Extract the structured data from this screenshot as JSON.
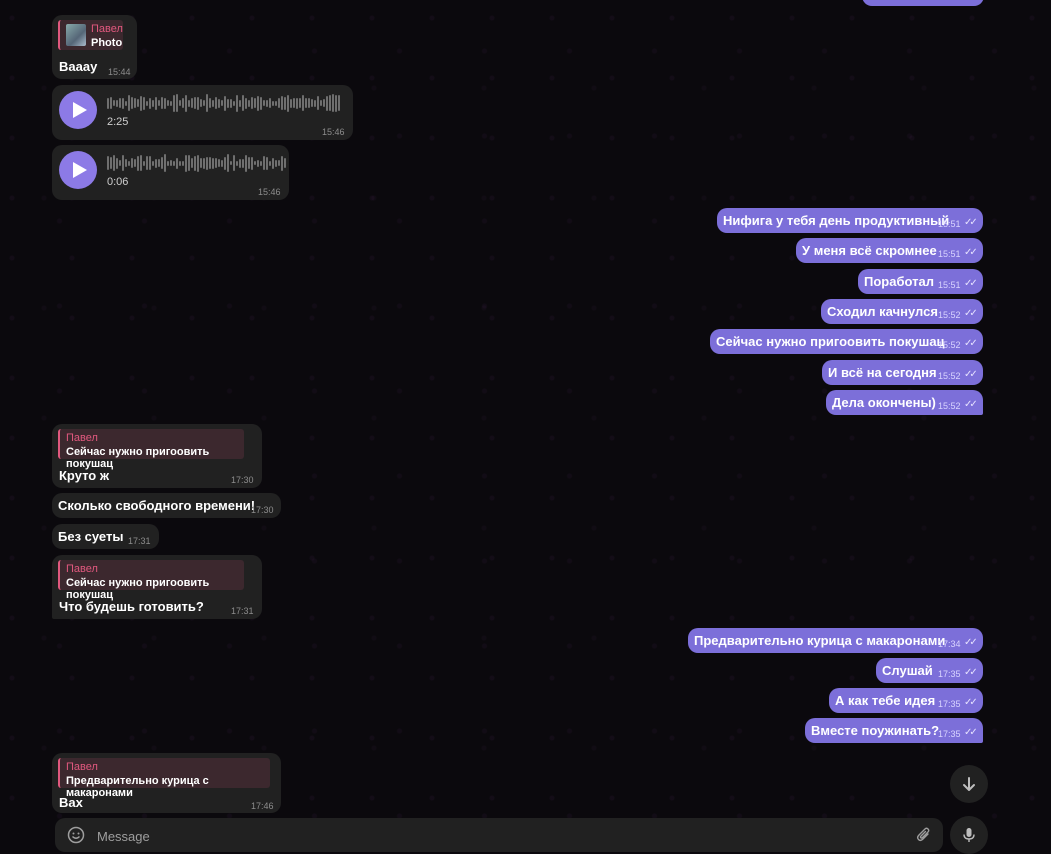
{
  "composer": {
    "placeholder": "Message"
  },
  "incoming": {
    "photo_reply": {
      "sender": "Павел",
      "label": "Photo",
      "text": "Вааау",
      "time": "15:44"
    },
    "voice1": {
      "duration": "2:25",
      "time": "15:46"
    },
    "voice2": {
      "duration": "0:06",
      "time": "15:46"
    },
    "reply1": {
      "sender": "Павел",
      "quote": "Сейчас нужно пригоовить покушац",
      "text": "Круто ж",
      "time": "17:30"
    },
    "m2": {
      "text": "Сколько свободного времени!",
      "time": "17:30"
    },
    "m3": {
      "text": "Без суеты",
      "time": "17:31"
    },
    "reply2": {
      "sender": "Павел",
      "quote": "Сейчас нужно пригоовить покушац",
      "text": "Что будешь готовить?",
      "time": "17:31"
    },
    "reply3": {
      "sender": "Павел",
      "quote": "Предварительно курица с макаронами",
      "text": "Вах",
      "time": "17:46"
    }
  },
  "outgoing": [
    {
      "text": "Нифига у тебя день продуктивный",
      "time": "15:51"
    },
    {
      "text": "У меня всё скромнее",
      "time": "15:51"
    },
    {
      "text": "Поработал",
      "time": "15:51"
    },
    {
      "text": "Сходил качнулся",
      "time": "15:52"
    },
    {
      "text": "Сейчас нужно пригоовить покушац",
      "time": "15:52"
    },
    {
      "text": "И всё на сегодня",
      "time": "15:52"
    },
    {
      "text": "Дела окончены)",
      "time": "15:52"
    },
    {
      "text": "Предварительно курица с макаронами",
      "time": "17:34"
    },
    {
      "text": "Слушай",
      "time": "17:35"
    },
    {
      "text": "А как тебе идея",
      "time": "17:35"
    },
    {
      "text": "Вместе поужинать?",
      "time": "17:35"
    }
  ],
  "icons": {
    "emoji": "smile-icon",
    "attach": "paperclip-icon",
    "mic": "microphone-icon",
    "scroll": "arrow-down-icon"
  },
  "colors": {
    "outgoing_bubble": "#7c6fd9",
    "incoming_bubble": "#212121",
    "reply_accent": "#e0587e",
    "play_button": "#8c7ae6"
  }
}
